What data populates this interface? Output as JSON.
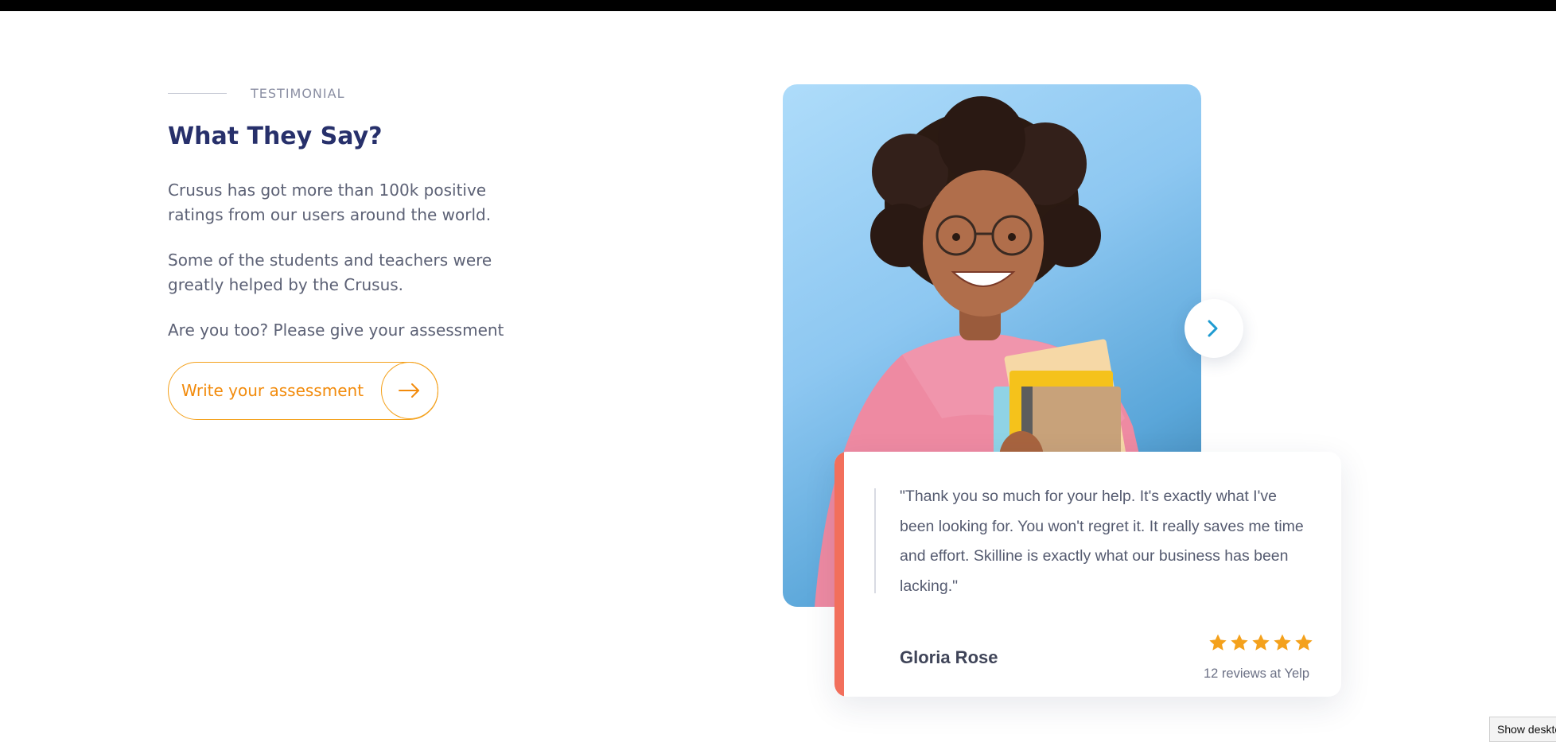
{
  "testimonial": {
    "eyebrow": "TESTIMONIAL",
    "heading": "What They Say?",
    "paragraphs": [
      "Crusus has got more than 100k positive ratings from our users around the world.",
      "Some of the students and teachers were greatly helped by the Crusus.",
      "Are you too? Please give your assessment"
    ],
    "cta_label": "Write your assessment"
  },
  "review": {
    "quote": "\"Thank you so much for your help. It's exactly what I've been looking for. You won't regret it. It really saves me time and effort. Skilline is exactly what our business has been lacking.\"",
    "author": "Gloria Rose",
    "rating": 5,
    "review_count_text": "12 reviews at Yelp"
  },
  "taskbar": {
    "tooltip": "Show desktop"
  },
  "colors": {
    "heading": "#27306b",
    "accent_orange": "#f28b0c",
    "card_accent": "#f26f5c",
    "star": "#f4a11c",
    "next_chevron": "#1f9bd1"
  },
  "icons": {
    "cta": "arrow-right-icon",
    "next": "chevron-right-icon",
    "rating": "star-icon"
  }
}
